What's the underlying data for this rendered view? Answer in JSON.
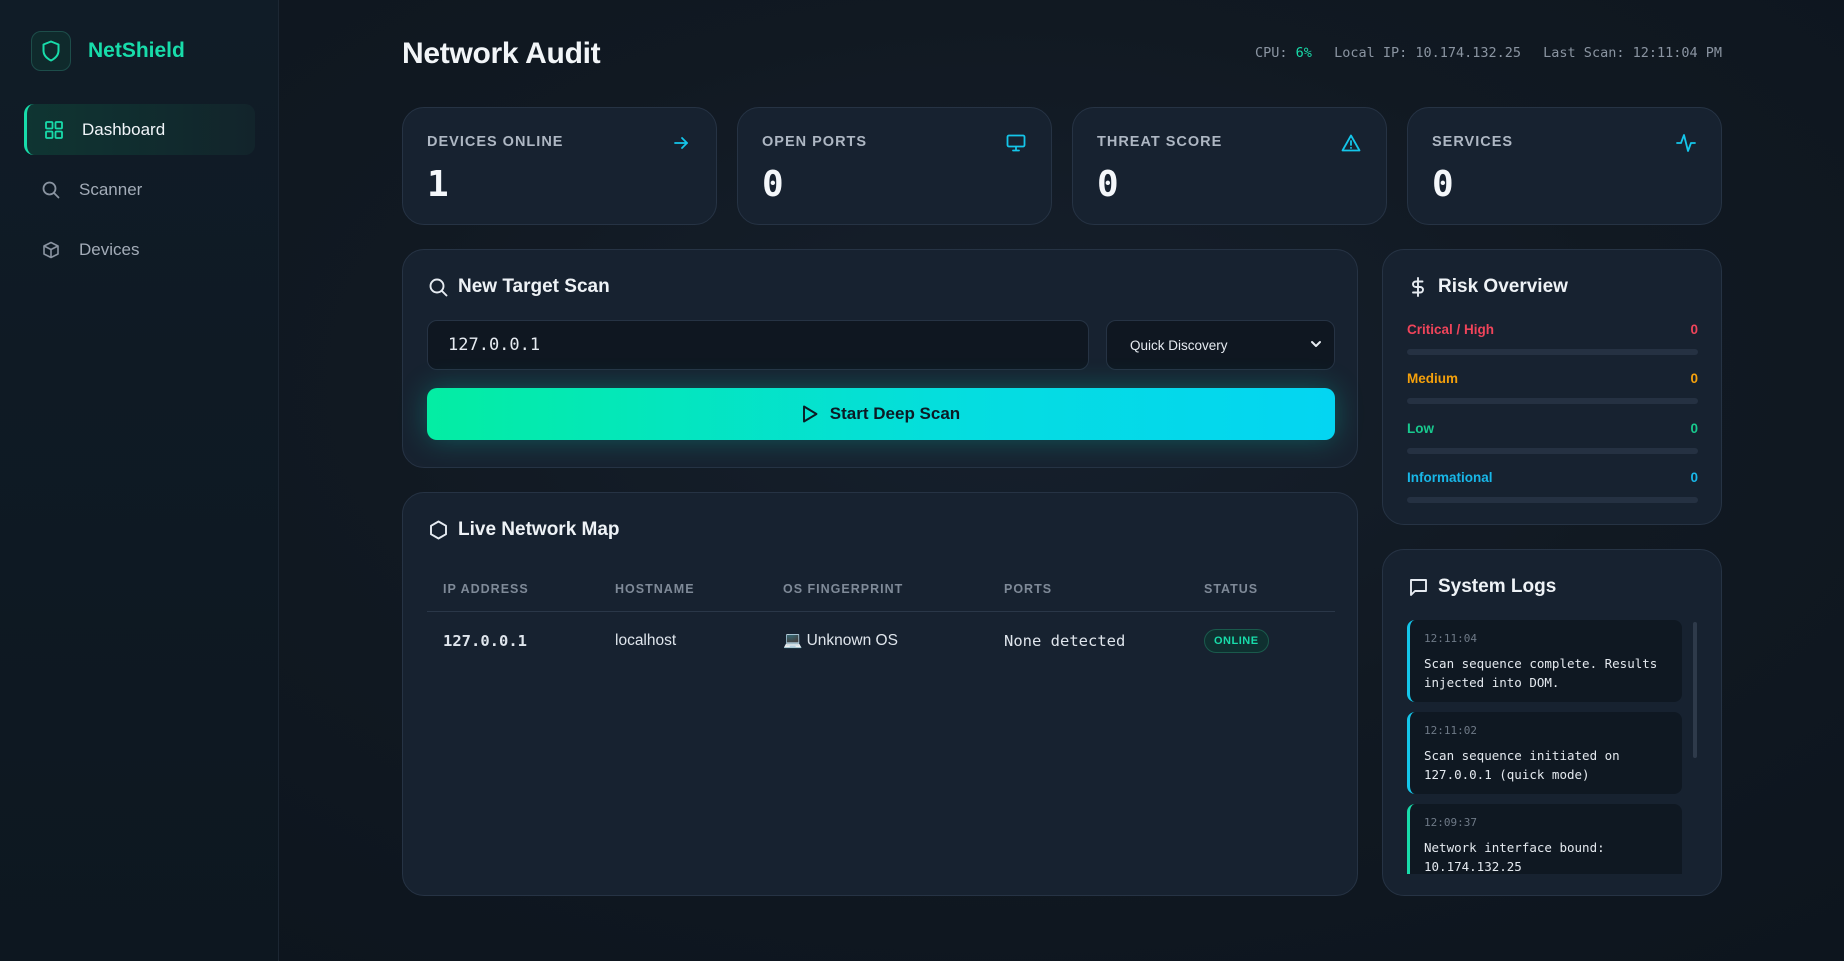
{
  "app": {
    "name": "NetShield"
  },
  "sidebar": {
    "items": [
      {
        "label": "Dashboard",
        "icon": "grid-icon",
        "active": true
      },
      {
        "label": "Scanner",
        "icon": "search-icon",
        "active": false
      },
      {
        "label": "Devices",
        "icon": "cube-icon",
        "active": false
      }
    ]
  },
  "header": {
    "title": "Network Audit",
    "cpu_label": "CPU:",
    "cpu_value": "6%",
    "ip_label": "Local IP:",
    "ip_value": "10.174.132.25",
    "last_scan_label": "Last Scan:",
    "last_scan_value": "12:11:04 PM"
  },
  "stats": [
    {
      "label": "DEVICES ONLINE",
      "value": "1",
      "icon": "arrow-right-icon"
    },
    {
      "label": "OPEN PORTS",
      "value": "0",
      "icon": "monitor-icon"
    },
    {
      "label": "THREAT SCORE",
      "value": "0",
      "icon": "warning-triangle-icon"
    },
    {
      "label": "SERVICES",
      "value": "0",
      "icon": "activity-icon"
    }
  ],
  "scan": {
    "title": "New Target Scan",
    "target_value": "127.0.0.1",
    "mode_selected": "Quick Discovery",
    "button_label": "Start Deep Scan"
  },
  "network_map": {
    "title": "Live Network Map",
    "columns": [
      "IP ADDRESS",
      "HOSTNAME",
      "OS FINGERPRINT",
      "PORTS",
      "STATUS"
    ],
    "rows": [
      {
        "ip": "127.0.0.1",
        "hostname": "localhost",
        "os": "💻 Unknown OS",
        "ports": "None detected",
        "status": "ONLINE"
      }
    ]
  },
  "risk": {
    "title": "Risk Overview",
    "levels": [
      {
        "label": "Critical / High",
        "count": "0",
        "color": "#f0445a",
        "fraction": 0
      },
      {
        "label": "Medium",
        "count": "0",
        "color": "#f5a10c",
        "fraction": 0
      },
      {
        "label": "Low",
        "count": "0",
        "color": "#18c98e",
        "fraction": 0
      },
      {
        "label": "Informational",
        "count": "0",
        "color": "#18b7e8",
        "fraction": 0
      }
    ]
  },
  "logs": {
    "title": "System Logs",
    "entries": [
      {
        "time": "12:11:04",
        "message": "Scan sequence complete. Results injected into DOM.",
        "color": "#14c6ea"
      },
      {
        "time": "12:11:02",
        "message": "Scan sequence initiated on 127.0.0.1 (quick mode)",
        "color": "#14c6ea"
      },
      {
        "time": "12:09:37",
        "message": "Network interface bound: 10.174.132.25",
        "color": "#18dcaa"
      }
    ]
  },
  "colors": {
    "accent": "#18dcaa",
    "cyan": "#14c6ea"
  }
}
